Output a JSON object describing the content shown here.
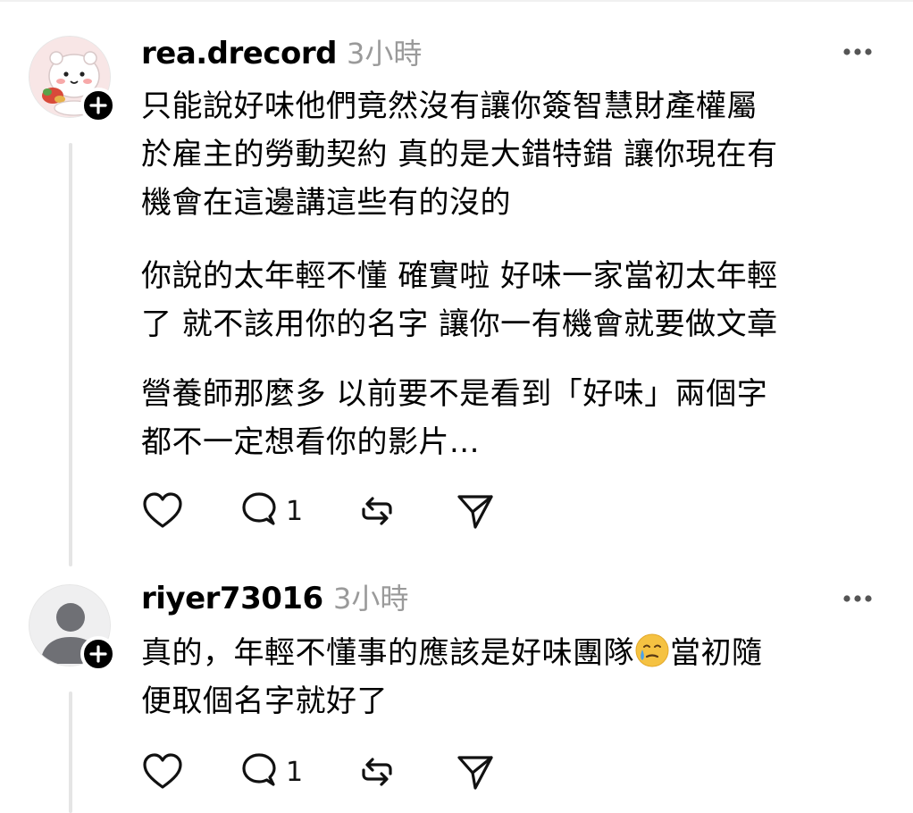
{
  "comments": [
    {
      "username": "rea.drecord",
      "time": "3小時",
      "paragraphs": [
        "只能說好味他們竟然沒有讓你簽智慧財產權屬\n於雇主的勞動契約 真的是大錯特錯 讓你現在有\n機會在這邊講這些有的沒的",
        "你說的太年輕不懂 確實啦 好味一家當初太年輕\n了 就不該用你的名字 讓你一有機會就要做文章",
        "營養師那麼多 以前要不是看到「好味」兩個字\n都不一定想看你的影片..."
      ],
      "reply_count": "1"
    },
    {
      "username": "riyer73016",
      "time": "3小時",
      "text_part1": "真的，年輕不懂事的應該是好味團隊",
      "emoji": "face-holding-back-tears-emoji",
      "text_part2": "當初隨",
      "text_line2": "便取個名字就好了",
      "reply_count": "1"
    }
  ],
  "icons": {
    "like": "heart-icon",
    "reply": "comment-bubble-icon",
    "repost": "repost-icon",
    "share": "send-icon",
    "more": "more-dots-icon",
    "follow": "plus-icon"
  }
}
